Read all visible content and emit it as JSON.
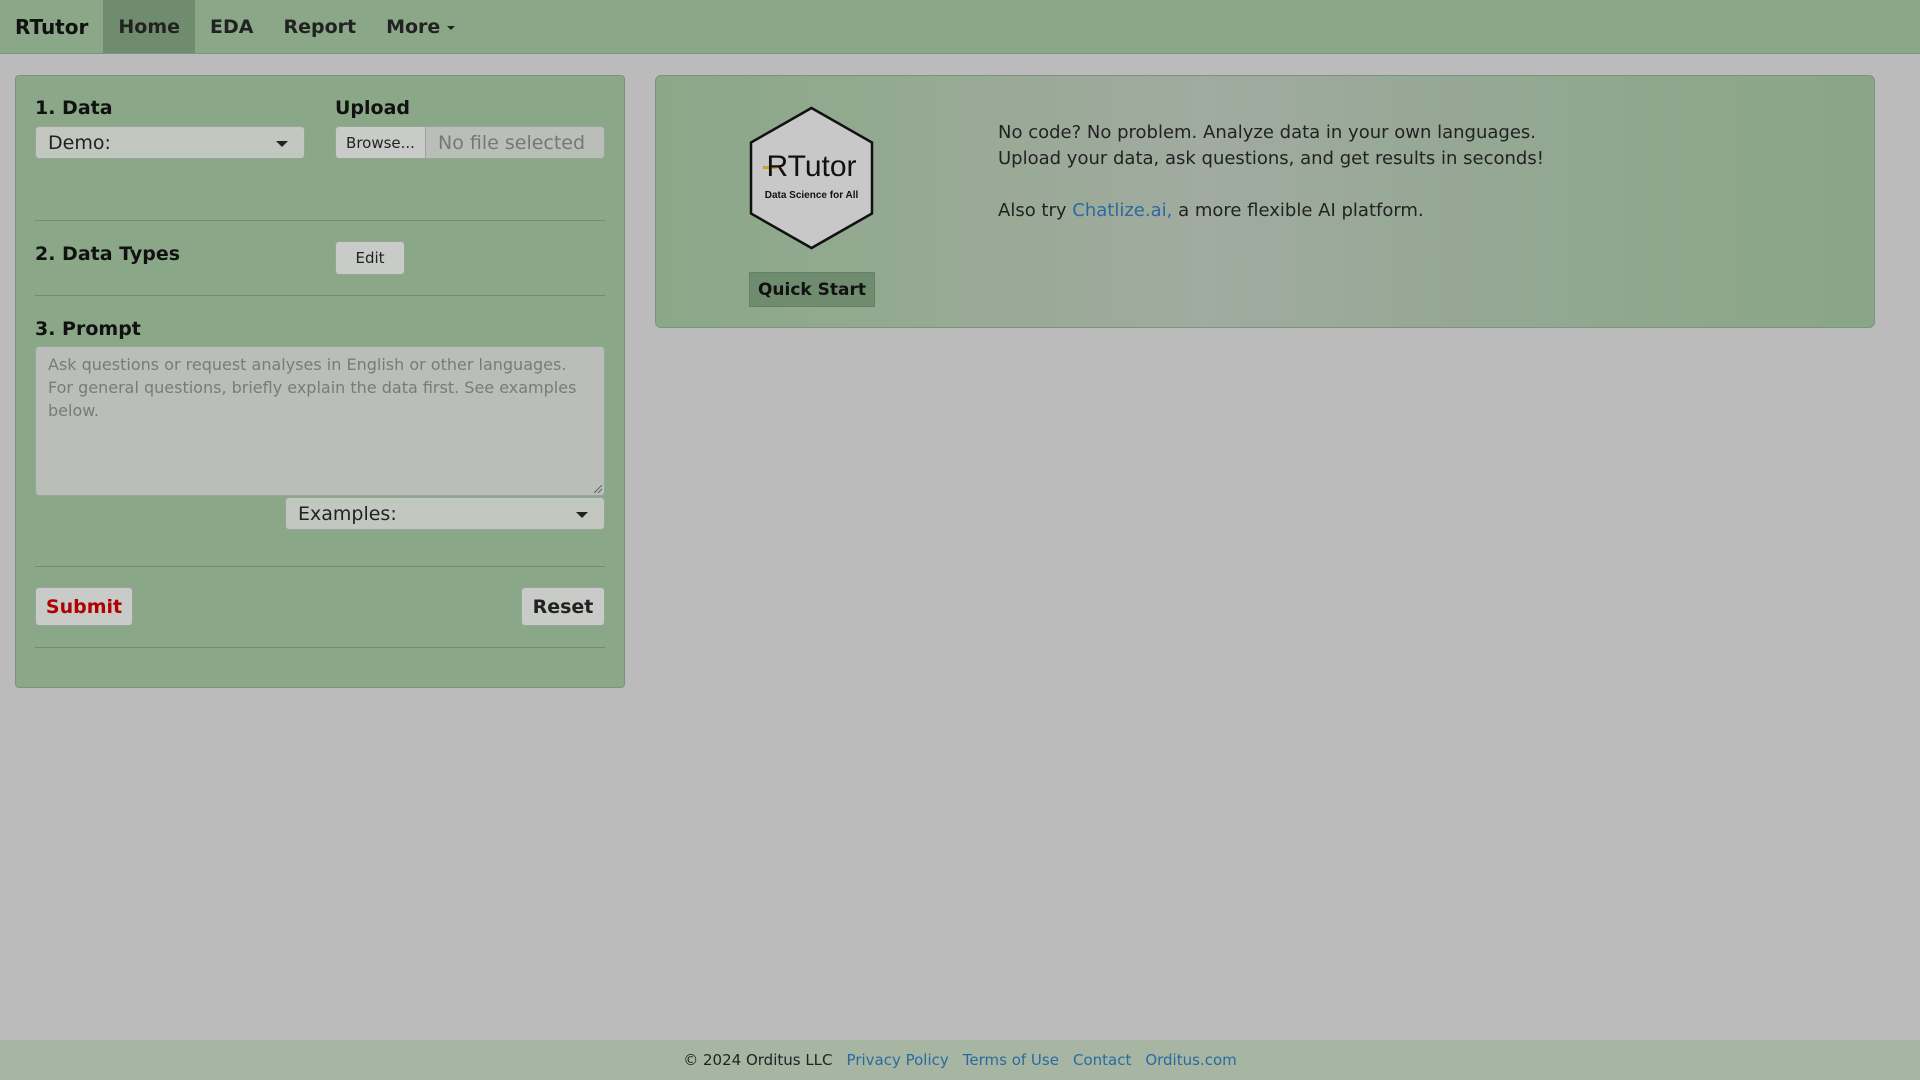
{
  "navbar": {
    "brand": "RTutor",
    "items": [
      {
        "label": "Home",
        "active": true
      },
      {
        "label": "EDA",
        "active": false
      },
      {
        "label": "Report",
        "active": false
      },
      {
        "label": "More",
        "active": false,
        "dropdown": true
      }
    ]
  },
  "sidebar": {
    "data_label": "1. Data",
    "data_select_value": "Demo:",
    "upload_label": "Upload",
    "browse_label": "Browse...",
    "file_placeholder": "No file selected",
    "data_types_label": "2. Data Types",
    "edit_label": "Edit",
    "prompt_label": "3. Prompt",
    "prompt_placeholder": "Ask questions or request analyses in English or other languages. For general questions, briefly explain the data first. See examples below.",
    "examples_select_value": "Examples:",
    "submit_label": "Submit",
    "reset_label": "Reset"
  },
  "hero": {
    "logo_title": "RTutor",
    "logo_subtitle": "Data Science for All",
    "quick_start_label": "Quick Start",
    "line1": "No code? No problem. Analyze data in your own languages.",
    "line2": "Upload your data, ask questions, and get results in seconds!",
    "line3_prefix": "Also try ",
    "line3_link": "Chatlize.ai,",
    "line3_suffix": " a more flexible AI platform."
  },
  "footer": {
    "copyright": "© 2024 Orditus LLC",
    "links": [
      "Privacy Policy",
      "Terms of Use",
      "Contact",
      "Orditus.com"
    ]
  },
  "colors": {
    "panel_green": "#8aa888",
    "active_green": "#6f8c6e",
    "background": "#bbbbbb",
    "link": "#2a6aa1",
    "submit": "#b00000"
  },
  "icons": [
    "chevron-down-icon",
    "rtutor-hexagon-logo",
    "resize-handle-icon"
  ]
}
